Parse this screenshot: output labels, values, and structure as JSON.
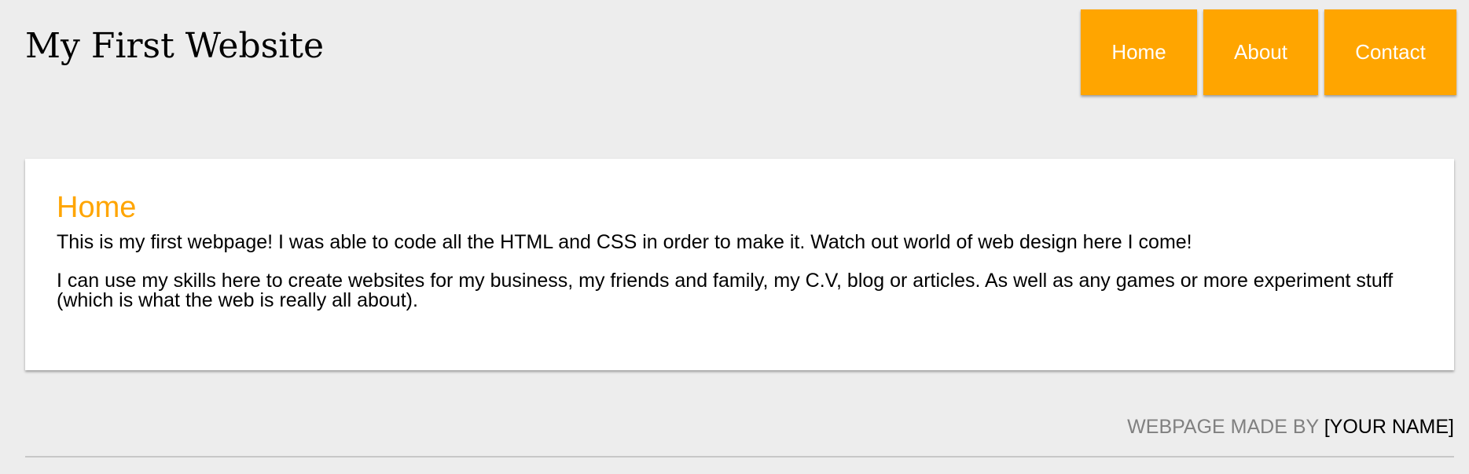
{
  "header": {
    "site_title": "My First Website",
    "nav": [
      {
        "label": "Home"
      },
      {
        "label": "About"
      },
      {
        "label": "Contact"
      }
    ]
  },
  "main": {
    "heading": "Home",
    "paragraphs": [
      "This is my first webpage! I was able to code all the HTML and CSS in order to make it. Watch out world of web design here I come!",
      "I can use my skills here to create websites for my business, my friends and family, my C.V, blog or articles. As well as any games or more experiment stuff (which is what the web is really all about)."
    ]
  },
  "footer": {
    "prefix": "WEBPAGE MADE BY ",
    "name": "[YOUR NAME]"
  },
  "colors": {
    "accent": "#ffa500",
    "background": "#ededed",
    "card": "#ffffff",
    "footer_prefix": "#808080"
  }
}
